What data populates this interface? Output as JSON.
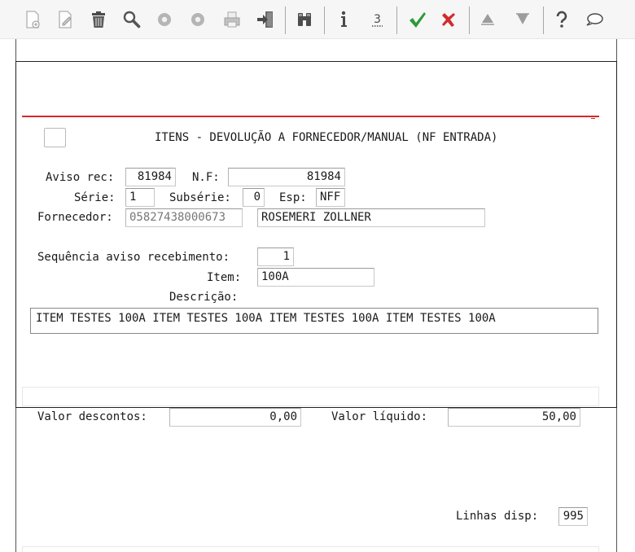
{
  "toolbar": {
    "buttons": [
      {
        "icon": "new-doc-icon",
        "enabled": false
      },
      {
        "icon": "edit-icon",
        "enabled": false
      },
      {
        "icon": "trash-icon",
        "enabled": true
      },
      {
        "icon": "search-icon",
        "enabled": true
      },
      {
        "icon": "previous-icon",
        "enabled": false
      },
      {
        "icon": "next-icon",
        "enabled": false
      },
      {
        "icon": "print-icon",
        "enabled": false
      },
      {
        "icon": "exit-icon",
        "enabled": true
      },
      {
        "icon": "binoculars-icon",
        "enabled": true
      },
      {
        "icon": "info-icon",
        "enabled": true
      },
      {
        "icon": "three-icon",
        "enabled": true
      },
      {
        "icon": "confirm-check-icon",
        "enabled": true
      },
      {
        "icon": "cancel-x-icon",
        "enabled": true
      },
      {
        "icon": "arrow-up-icon",
        "enabled": false
      },
      {
        "icon": "arrow-down-icon",
        "enabled": false
      },
      {
        "icon": "help-icon",
        "enabled": true
      },
      {
        "icon": "chat-bubble-icon",
        "enabled": true
      }
    ],
    "colors": {
      "check": "#2e9a3a",
      "cancel": "#d22b2b",
      "gray": "#9c9c9c",
      "dark": "#4a4a4a"
    }
  },
  "title": "ITENS - DEVOLUÇÃO A FORNECEDOR/MANUAL (NF ENTRADA)",
  "form": {
    "aviso_rec_label": "Aviso rec:",
    "aviso_rec_value": "81984",
    "nf_label": "N.F:",
    "nf_value": "81984",
    "serie_label": "Série:",
    "serie_value": "1",
    "subserie_label": "Subsérie:",
    "subserie_value": "0",
    "esp_label": "Esp:",
    "esp_value": "NFF",
    "fornecedor_label": "Fornecedor:",
    "fornecedor_code": "05827438000673",
    "fornecedor_name": "ROSEMERI ZOLLNER",
    "sequencia_label": "Sequência aviso recebimento:",
    "sequencia_value": "1",
    "item_label": "Item:",
    "item_value": "100A",
    "descricao_label": "Descrição:",
    "descricao_value": "ITEM TESTES 100A ITEM TESTES 100A ITEM TESTES 100A ITEM TESTES 100A"
  },
  "totals": {
    "valor_descontos_label": "Valor descontos:",
    "valor_descontos_value": "0,00",
    "valor_liquido_label": "Valor líquido:",
    "valor_liquido_value": "50,00",
    "linhas_disp_label": "Linhas disp:",
    "linhas_disp_value": "995"
  },
  "accent_color": "#d9262b"
}
